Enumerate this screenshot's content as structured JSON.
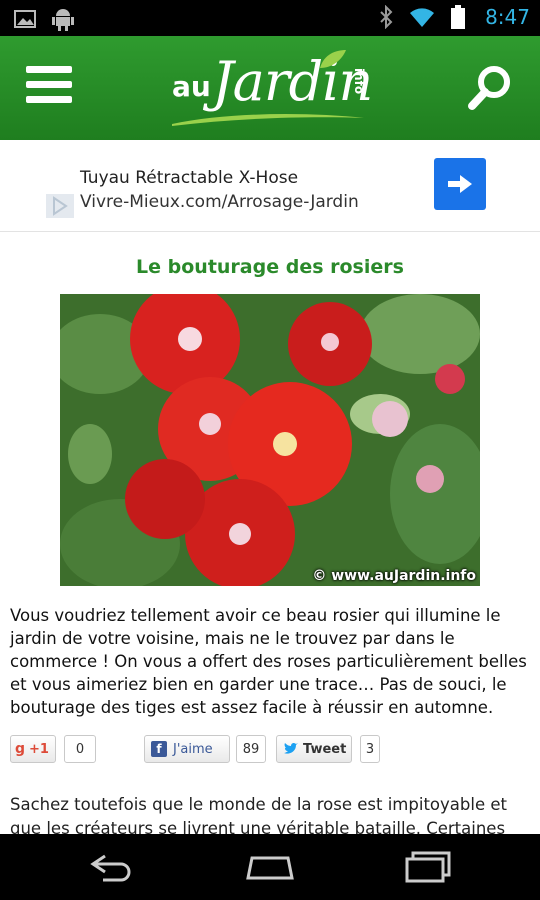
{
  "status_bar": {
    "time": "8:47",
    "icons_left": [
      "image-icon",
      "android-icon"
    ],
    "icons_right": [
      "bluetooth-icon",
      "wifi-icon",
      "battery-icon"
    ]
  },
  "header": {
    "logo_prefix": "au",
    "logo_main": "Jardin",
    "logo_suffix": "info",
    "menu_icon": "menu-icon",
    "search_icon": "search-icon",
    "color": "#2a8f2a"
  },
  "ad": {
    "title": "Tuyau Rétractable X-Hose",
    "url": "Vivre-Mieux.com/Arrosage-Jardin",
    "button_icon": "arrow-right-icon",
    "button_color": "#1a73e8"
  },
  "article": {
    "title": "Le bouturage des rosiers",
    "image_credit": "© www.auJardin.info",
    "intro": "Vous voudriez tellement avoir ce beau rosier qui illumine le jardin de votre voisine, mais ne le trouvez par dans le commerce ! On vous a offert des roses particulièrement belles et vous aimeriez bien en garder une trace… Pas de souci, le bouturage des tiges est assez facile à réussir en automne.",
    "body": "Sachez toutefois que le monde de la rose est impitoyable et que les créateurs se livrent une véritable bataille. Certaines roses"
  },
  "share": {
    "gplus_label": "+1",
    "gplus_count": "0",
    "fb_label": "J'aime",
    "fb_count": "89",
    "tweet_label": "Tweet",
    "tweet_count": "3"
  },
  "navbar": {
    "icons": [
      "back-icon",
      "home-icon",
      "recent-apps-icon"
    ]
  }
}
